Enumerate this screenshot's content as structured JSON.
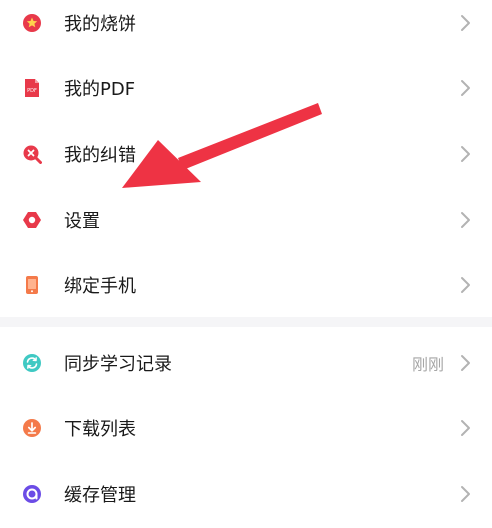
{
  "menu_top": {
    "items": [
      {
        "label": "我的烧饼",
        "icon": "star-badge-icon"
      },
      {
        "label": "我的PDF",
        "icon": "pdf-file-icon"
      },
      {
        "label": "我的纠错",
        "icon": "error-search-icon"
      },
      {
        "label": "设置",
        "icon": "gear-icon"
      },
      {
        "label": "绑定手机",
        "icon": "phone-icon"
      }
    ]
  },
  "menu_bottom": {
    "items": [
      {
        "label": "同步学习记录",
        "icon": "sync-icon",
        "meta": "刚刚"
      },
      {
        "label": "下载列表",
        "icon": "download-icon"
      },
      {
        "label": "缓存管理",
        "icon": "cache-icon"
      }
    ]
  },
  "colors": {
    "icon_red": "#e8394a",
    "icon_orange": "#f47a4a",
    "icon_teal": "#3fc9c3",
    "icon_purple": "#6b4ce6",
    "annotation_arrow": "#ee3344"
  }
}
